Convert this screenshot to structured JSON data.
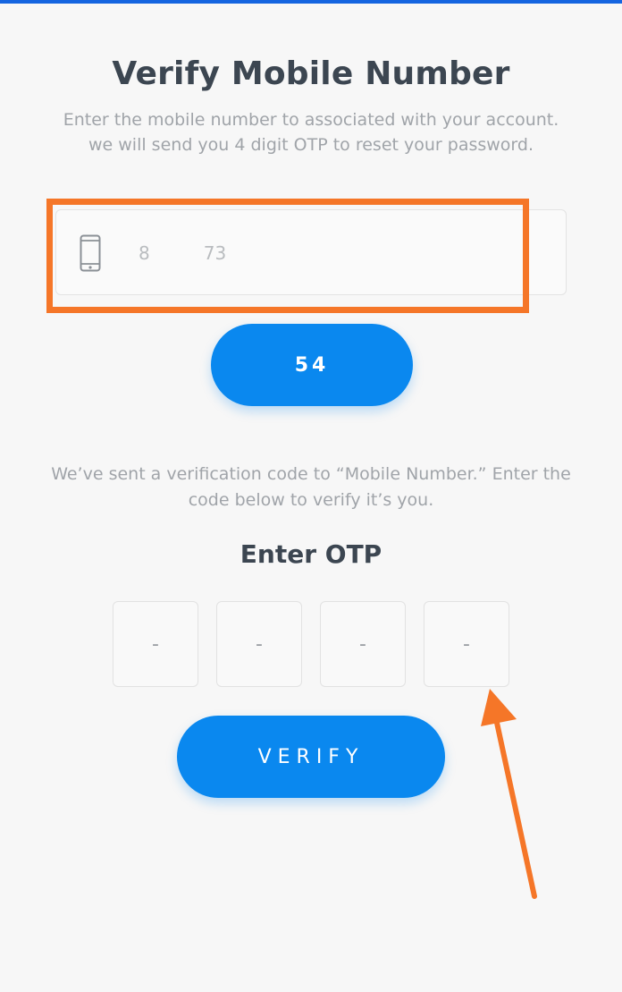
{
  "page": {
    "title": "Verify Mobile Number",
    "subtitle": "Enter the mobile number to associated with your account. we will send you 4 digit OTP to reset your password."
  },
  "phone_field": {
    "value": "8      73",
    "icon": "mobile-phone-icon"
  },
  "timer_button": {
    "label": "54"
  },
  "sent_message": "We’ve sent a verification code to “Mobile Number.” Enter the code below to verify it’s you.",
  "otp": {
    "label": "Enter OTP",
    "digits": [
      "-",
      "-",
      "-",
      "-"
    ]
  },
  "verify_button": {
    "label": "VERIFY"
  },
  "annotations": {
    "highlight_color": "#f57628",
    "arrow_color": "#f57628"
  },
  "colors": {
    "primary": "#0a88ef",
    "top_bar": "#1565e0",
    "background": "#f7f7f7"
  }
}
